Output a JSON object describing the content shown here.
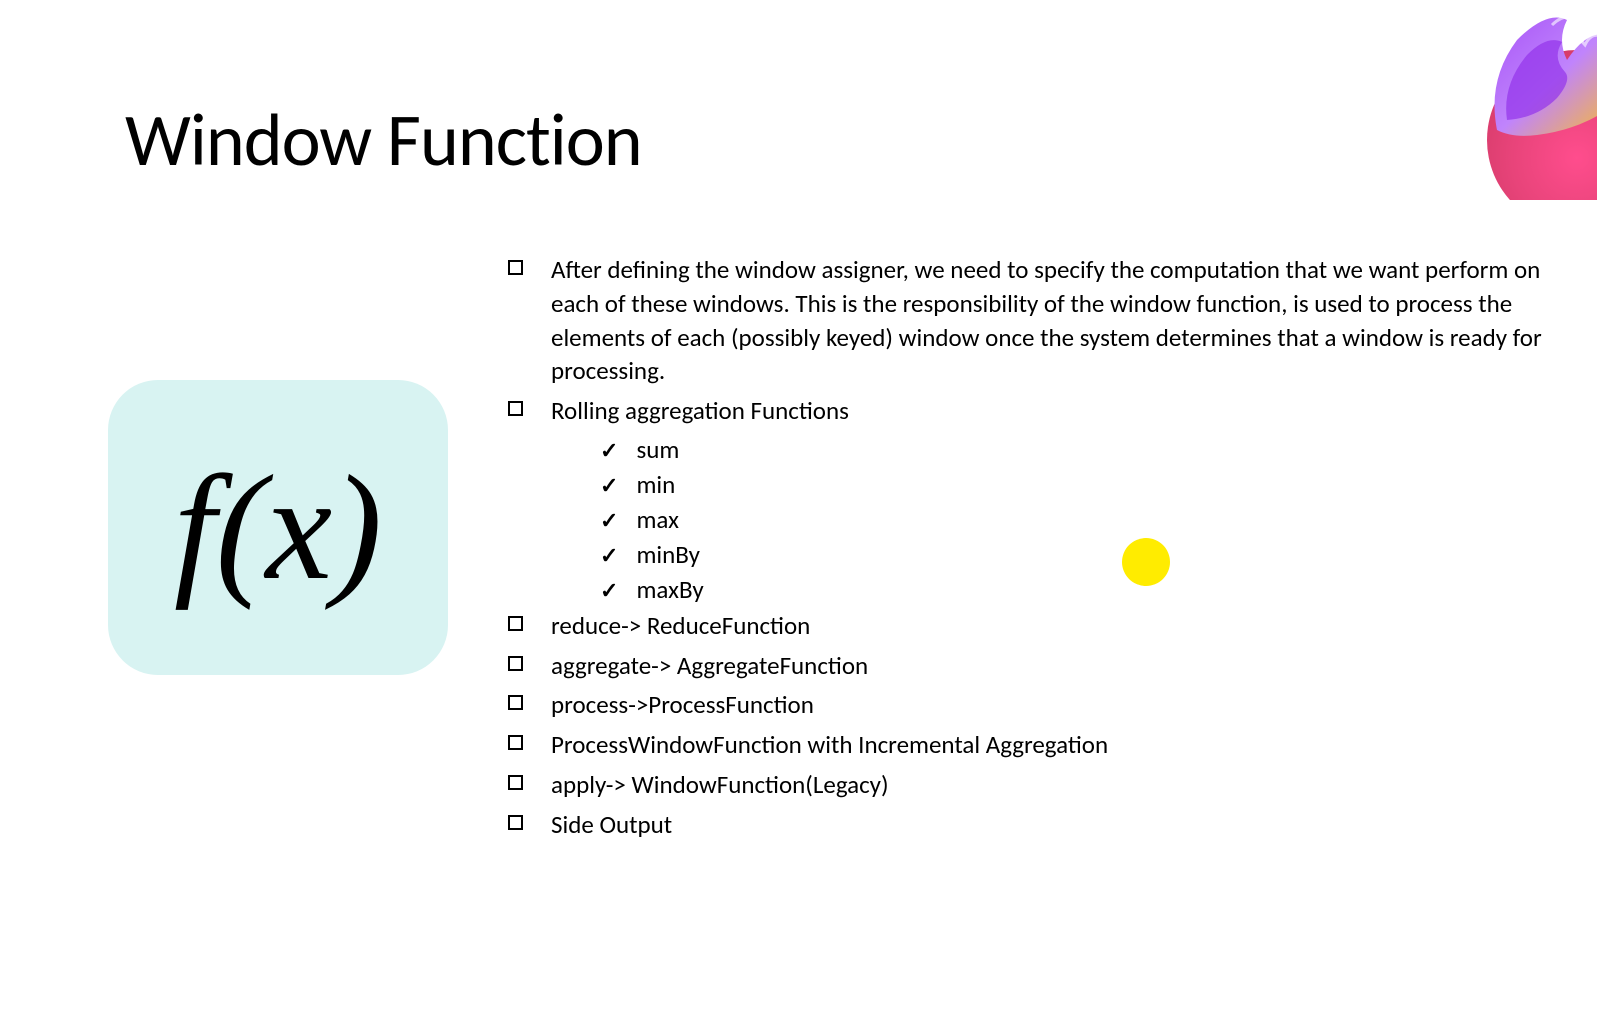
{
  "title": "Window Function",
  "fx_label": "f(x)",
  "bullets": {
    "b1": "After defining the window assigner, we need to specify the computation that we want perform on each of these windows. This is the responsibility of the window function, is used to process the elements of each (possibly keyed) window once the system determines that a window is ready for processing.",
    "b2": "Rolling aggregation Functions",
    "b2_subs": {
      "s1": "sum",
      "s2": "min",
      "s3": "max",
      "s4": "minBy",
      "s5": "maxBy"
    },
    "b3": "reduce-> ReduceFunction",
    "b4": "aggregate-> AggregateFunction",
    "b5": "process->ProcessFunction",
    "b6": "ProcessWindowFunction with Incremental Aggregation",
    "b7": "apply-> WindowFunction(Legacy)",
    "b8": "Side Output"
  }
}
